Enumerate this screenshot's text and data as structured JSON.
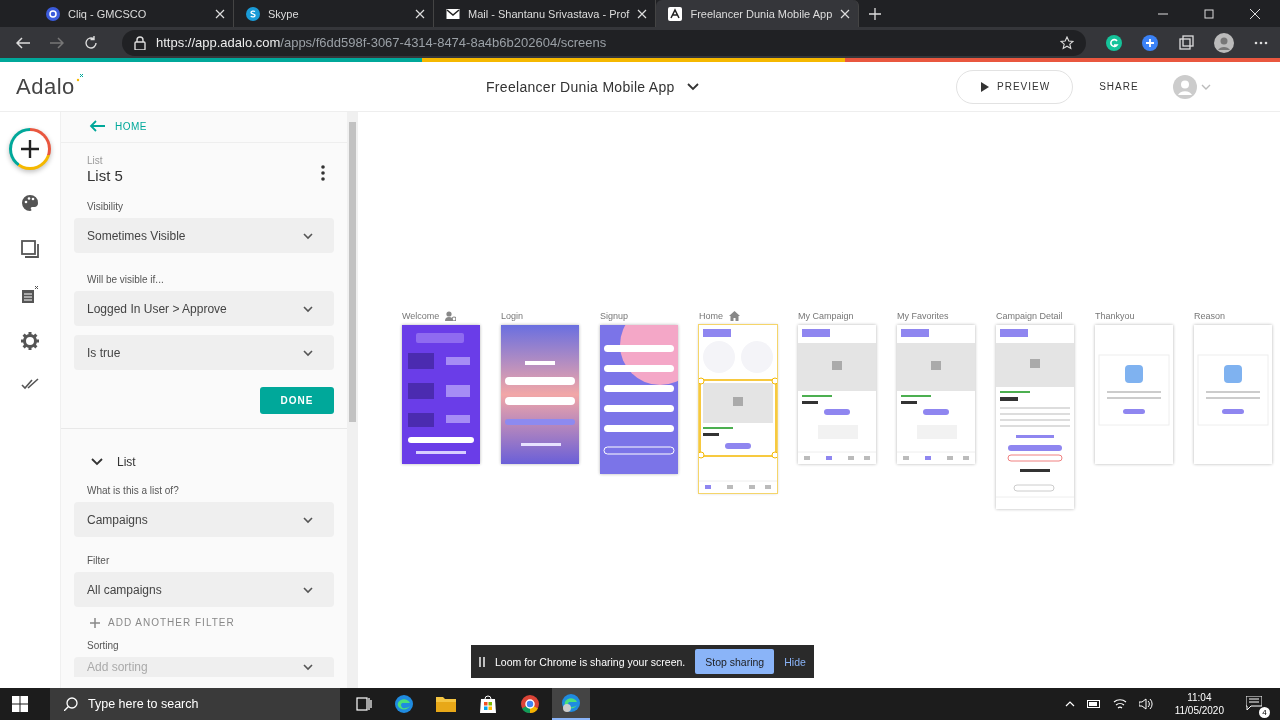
{
  "browser": {
    "tabs": [
      {
        "title": "Cliq - GMCSCO",
        "selected": false
      },
      {
        "title": "Skype",
        "selected": false
      },
      {
        "title": "Mail - Shantanu Srivastava - Prof",
        "selected": false
      },
      {
        "title": "Freelancer Dunia Mobile App",
        "selected": true
      }
    ],
    "url_host": "https://app.adalo.com",
    "url_path": "/apps/f6dd598f-3067-4314-8474-8a4b6b202604/screens"
  },
  "header": {
    "logo": "Adalo",
    "app_name": "Freelancer Dunia Mobile App",
    "preview": "PREVIEW",
    "share": "SHARE"
  },
  "panel": {
    "back": "HOME",
    "caption": "List",
    "title": "List 5",
    "fields": [
      {
        "kind": "label",
        "text": "Visibility"
      },
      {
        "kind": "select",
        "value": "Sometimes Visible"
      },
      {
        "kind": "label",
        "text": "Will be visible if..."
      },
      {
        "kind": "select",
        "value": "Logged In User > Approve"
      },
      {
        "kind": "select",
        "value": "Is true"
      }
    ],
    "done": "DONE",
    "section": "List",
    "section_expanded": true,
    "list_fields": [
      {
        "kind": "label",
        "text": "What is this a list of?"
      },
      {
        "kind": "select",
        "value": "Campaigns"
      },
      {
        "kind": "label",
        "text": "Filter"
      },
      {
        "kind": "select",
        "value": "All campaigns"
      },
      {
        "kind": "link",
        "text": "ADD ANOTHER FILTER"
      },
      {
        "kind": "label",
        "text": "Sorting"
      },
      {
        "kind": "select",
        "placeholder": "Add sorting"
      }
    ]
  },
  "screens": [
    {
      "name": "Welcome",
      "start_screen": true,
      "home_screen": false,
      "kind": "purple",
      "selected": false
    },
    {
      "name": "Login",
      "start_screen": false,
      "home_screen": false,
      "kind": "gradient",
      "selected": false
    },
    {
      "name": "Signup",
      "start_screen": false,
      "home_screen": false,
      "kind": "signup",
      "selected": false
    },
    {
      "name": "Home",
      "start_screen": false,
      "home_screen": true,
      "kind": "home",
      "selected": true
    },
    {
      "name": "My Campaign",
      "start_screen": false,
      "home_screen": false,
      "kind": "list",
      "selected": false
    },
    {
      "name": "My Favorites",
      "start_screen": false,
      "home_screen": false,
      "kind": "list",
      "selected": false
    },
    {
      "name": "Campaign Detail",
      "start_screen": false,
      "home_screen": false,
      "kind": "detail",
      "selected": false
    },
    {
      "name": "Thankyou",
      "start_screen": false,
      "home_screen": false,
      "kind": "modal",
      "selected": false
    },
    {
      "name": "Reason",
      "start_screen": false,
      "home_screen": false,
      "kind": "modal",
      "selected": false
    }
  ],
  "loom": {
    "message": "Loom for Chrome is sharing your screen.",
    "stop": "Stop sharing",
    "hide": "Hide"
  },
  "taskbar": {
    "search": "Type here to search",
    "time": "11:04",
    "date": "11/05/2020",
    "notifications": "4"
  }
}
